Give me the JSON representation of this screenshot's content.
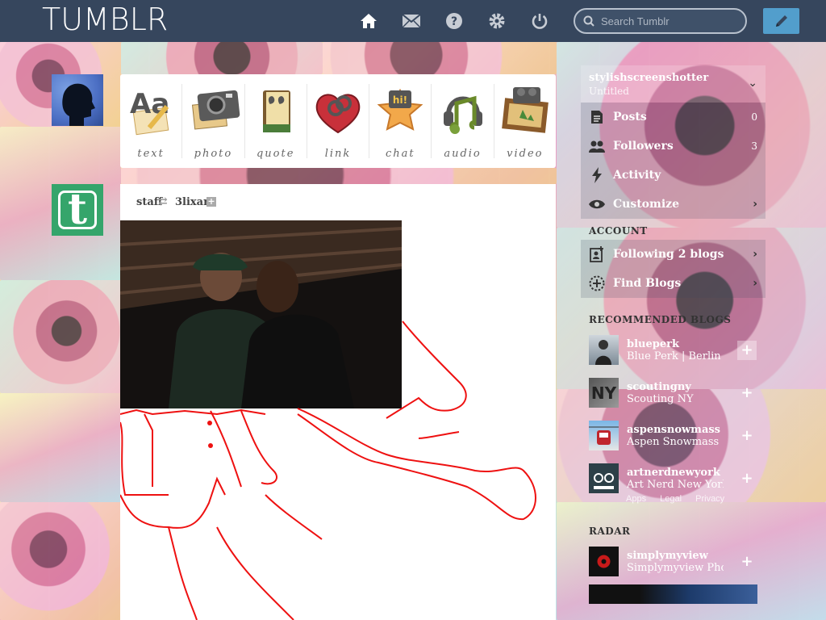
{
  "header": {
    "logo": "TUMBLR",
    "search_placeholder": "Search Tumblr",
    "nav": [
      "home-icon",
      "mail-icon",
      "help-icon",
      "settings-icon",
      "power-icon"
    ]
  },
  "post_types": [
    {
      "label": "text"
    },
    {
      "label": "photo"
    },
    {
      "label": "quote"
    },
    {
      "label": "link"
    },
    {
      "label": "chat"
    },
    {
      "label": "audio"
    },
    {
      "label": "video"
    }
  ],
  "post": {
    "author": "staff",
    "reblogged_from": "3lixar",
    "follow_symbol": "+"
  },
  "sidebar": {
    "blog_name": "stylishscreenshotter",
    "blog_subtitle": "Untitled",
    "items": [
      {
        "label": "Posts",
        "count": "0"
      },
      {
        "label": "Followers",
        "count": "3"
      },
      {
        "label": "Activity"
      },
      {
        "label": "Customize"
      }
    ],
    "account_heading": "ACCOUNT",
    "account_items": [
      {
        "label": "Following 2 blogs"
      },
      {
        "label": "Find Blogs"
      }
    ],
    "recommended_heading": "RECOMMENDED BLOGS",
    "recommended": [
      {
        "name": "blueperk",
        "desc": "Blue Perk | Berlin based"
      },
      {
        "name": "scoutingny",
        "desc": "Scouting NY"
      },
      {
        "name": "aspensnowmass",
        "desc": "Aspen Snowmass"
      },
      {
        "name": "artnerdnewyork",
        "desc": "Art Nerd New York"
      }
    ],
    "footer_links": [
      "Apps",
      "Legal",
      "Privacy"
    ],
    "radar_heading": "RADAR",
    "radar": {
      "name": "simplymyview",
      "desc": "Simplymyview Photography"
    }
  }
}
